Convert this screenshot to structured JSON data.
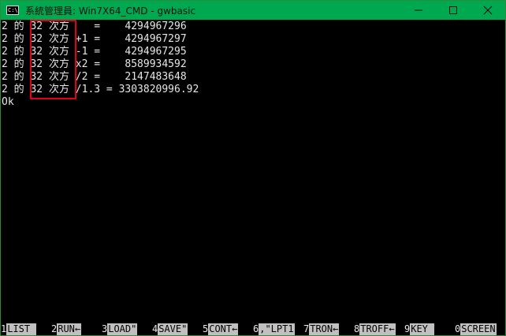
{
  "window": {
    "icon_text": "C:\\",
    "title": "系統管理員: Win7X64_CMD - gwbasic",
    "accent_color": "#00a84f",
    "controls": [
      "minimize-icon",
      "maximize-icon",
      "close-icon"
    ]
  },
  "console": {
    "lines": [
      "2 的 32 次方    =    4294967296",
      "2 的 32 次方 +1 =    4294967297",
      "2 的 32 次方 -1 =    4294967295",
      "2 的 32 次方 x2 =    8589934592",
      "2 的 32 次方 /2 =    2147483648",
      "2 的 32 次方 /1.3 = 3303820996.92",
      "Ok"
    ],
    "highlight_color": "#e0001b"
  },
  "function_keys": [
    {
      "num": "1",
      "label": "LIST "
    },
    {
      "num": "2",
      "label": "RUN←"
    },
    {
      "num": "3",
      "label": "LOAD\""
    },
    {
      "num": "4",
      "label": "SAVE\""
    },
    {
      "num": "5",
      "label": "CONT←"
    },
    {
      "num": "6",
      "label": ",\"LPT1"
    },
    {
      "num": "7",
      "label": "TRON←"
    },
    {
      "num": "8",
      "label": "TROFF←"
    },
    {
      "num": "9",
      "label": "KEY "
    },
    {
      "num": "0",
      "label": "SCREEN"
    }
  ]
}
